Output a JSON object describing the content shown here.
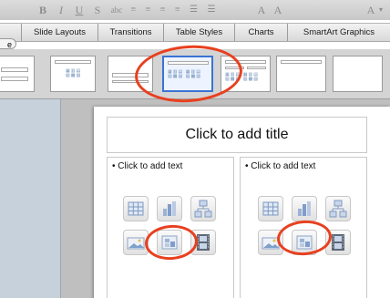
{
  "format_bar": {
    "buttons": [
      "B",
      "I",
      "U",
      "S",
      "A",
      "A",
      "A"
    ]
  },
  "ribbon": {
    "tabs": [
      "Slide Layouts",
      "Transitions",
      "Table Styles",
      "Charts",
      "SmartArt Graphics"
    ],
    "cut_tab_fragment": "e"
  },
  "slide": {
    "title_placeholder": "Click to add title",
    "content_placeholders": [
      "• Click to add text",
      "• Click to add text"
    ]
  },
  "content_icons": [
    "table-icon",
    "chart-icon",
    "smartart-icon",
    "picture-icon",
    "clip-art-icon",
    "movie-icon"
  ],
  "colors": {
    "highlight_circle": "#e8401f",
    "selected_layout": "#3b73d4",
    "left_panel": "#c7d1dc"
  }
}
